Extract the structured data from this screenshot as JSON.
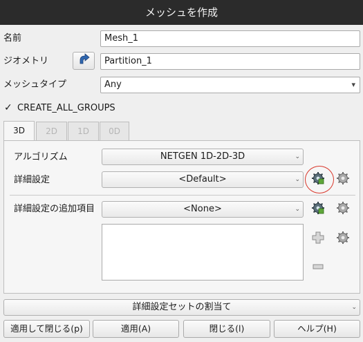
{
  "window": {
    "title": "メッシュを作成"
  },
  "form": {
    "name_label": "名前",
    "name_value": "Mesh_1",
    "geometry_label": "ジオメトリ",
    "geometry_value": "Partition_1",
    "mesh_type_label": "メッシュタイプ",
    "mesh_type_value": "Any",
    "create_groups_label": "CREATE_ALL_GROUPS",
    "create_groups_checked": true,
    "checkmark": "✓"
  },
  "tabs": [
    {
      "label": "3D",
      "active": true
    },
    {
      "label": "2D",
      "active": false
    },
    {
      "label": "1D",
      "active": false
    },
    {
      "label": "0D",
      "active": false
    }
  ],
  "panel": {
    "algorithm_label": "アルゴリズム",
    "algorithm_value": "NETGEN 1D-2D-3D",
    "hypothesis_label": "詳細設定",
    "hypothesis_value": "<Default>",
    "additional_label": "詳細設定の追加項目",
    "additional_value": "<None>",
    "edit_icon": "gear-edit-icon",
    "new_icon": "gear-new-icon",
    "add_icon": "plus-icon",
    "remove_icon": "minus-icon",
    "highlight_color": "#d9382c"
  },
  "assign_set": {
    "label": "詳細設定セットの割当て"
  },
  "buttons": {
    "apply_close": "適用して閉じる(p)",
    "apply": "適用(A)",
    "close": "閉じる(l)",
    "help": "ヘルプ(H)"
  },
  "combo_arrow": "⌄",
  "select_arrow": "▾"
}
